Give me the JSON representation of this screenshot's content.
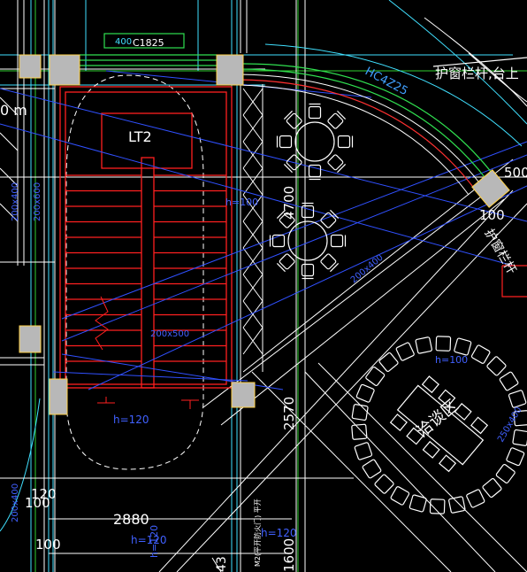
{
  "labels": {
    "window_code": "C1825",
    "window_dim": "400",
    "stair_tag": "LT2",
    "railing_code": "HC4Z25",
    "railing_note": "护窗栏杆,台上",
    "railing_note_right": "护窗栏杆",
    "dim_4700": "4700",
    "dim_2570": "2570",
    "dim_2880": "2880",
    "dim_1600": "1600",
    "dim_120": "120",
    "dim_100a": "100",
    "dim_100b": "100",
    "dim_100_right": "100",
    "dim_500_right": "500",
    "beam_200x400": "200x400",
    "beam_200x500": "200x500",
    "beam_200x400_left": "200x400",
    "beam_200x600_left": "200x600",
    "beam_200x400_bottom": "200x400",
    "beam_250x400_right": "250x400",
    "h_120": "h=120",
    "h_100": "h=100",
    "h_100_stair": "h=100",
    "h_120_bottom": "h=120",
    "h_120_vert": "h=120",
    "h_left_top": "h=",
    "lounge_label": "洽谈区",
    "vertical_note": "M2(平开防火门) 平开",
    "left_mark": "0 m",
    "bottom_mark_43": "43",
    "h_120_bottom2": "h=120"
  },
  "colors": {
    "background": "#000000",
    "wall": "#ffffff",
    "stair": "#ff2020",
    "column": "#b8b8b8",
    "column_edge": "#ffd24a",
    "window": "#30e050",
    "beam": "#4060ff",
    "axis": "#30d030",
    "cyan": "#40e0ff",
    "dim_text": "#ffffff"
  }
}
